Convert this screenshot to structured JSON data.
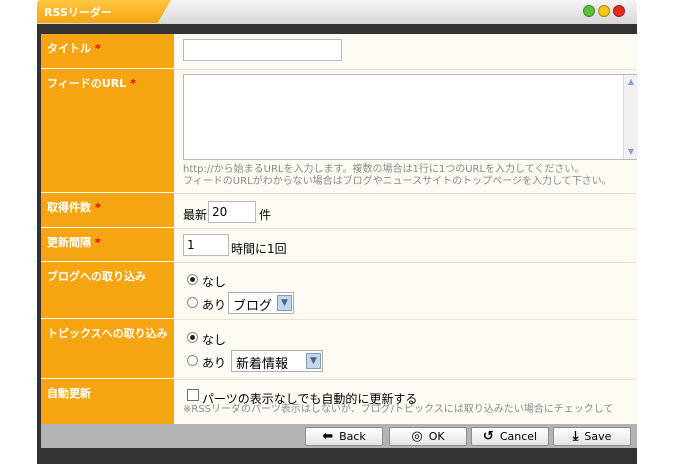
{
  "window": {
    "title": "RSSリーダー",
    "controls": [
      "minimize-dot",
      "maximize-dot",
      "close-dot"
    ],
    "colors": {
      "accent": "#f5a511",
      "dark": "#333333",
      "dot_green": "#5cc23a",
      "dot_yellow": "#f5c518",
      "dot_red": "#e52c1f"
    }
  },
  "form": {
    "title": {
      "label": "タイトル",
      "required": "*",
      "value": ""
    },
    "feed_url": {
      "label": "フィードのURL",
      "required": "*",
      "value": "",
      "help1": "http://から始まるURLを入力します。複数の場合は1行に1つのURLを入力してください。",
      "help2": "フィードのURLがわからない場合はブログやニュースサイトのトップページを入力して下さい。"
    },
    "count": {
      "label": "取得件数",
      "required": "*",
      "prefix": "最新",
      "value": "20",
      "suffix": "件"
    },
    "interval": {
      "label": "更新間隔",
      "required": "*",
      "value": "1",
      "suffix": "時間に1回"
    },
    "blog_import": {
      "label": "ブログへの取り込み",
      "option_none": "なし",
      "option_yes": "あり",
      "selected": "none",
      "select_value": "ブログ"
    },
    "topics_import": {
      "label": "トピックスへの取り込み",
      "option_none": "なし",
      "option_yes": "あり",
      "selected": "none",
      "select_value": "新着情報"
    },
    "auto_update": {
      "label": "自動更新",
      "checkbox_label": "パーツの表示なしでも自動的に更新する",
      "checked": false,
      "note": "※RSSリーダのパーツ表示はしないが、ブログ/トピックスには取り込みたい場合にチェックして"
    }
  },
  "footer": {
    "back": "Back",
    "ok": "OK",
    "cancel": "Cancel",
    "save": "Save"
  }
}
